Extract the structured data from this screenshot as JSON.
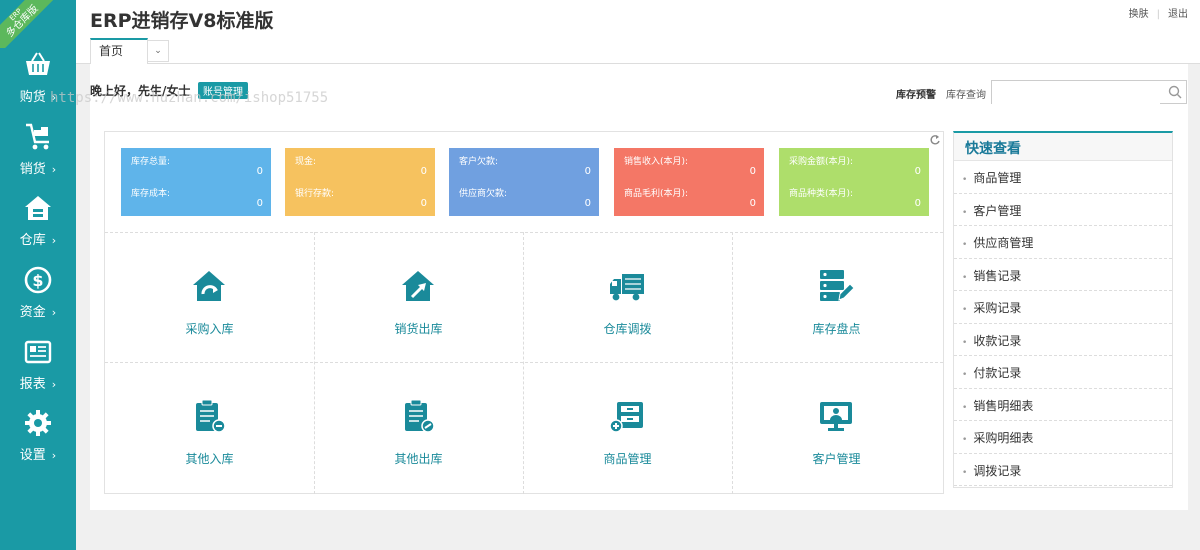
{
  "ribbon": {
    "small": "ERP",
    "text": "多仓库版"
  },
  "sidebar": {
    "items": [
      {
        "label": "购货",
        "chevron": "›",
        "icon": "basket-icon"
      },
      {
        "label": "销货",
        "chevron": "›",
        "icon": "cart-icon"
      },
      {
        "label": "仓库",
        "chevron": "›",
        "icon": "warehouse-icon"
      },
      {
        "label": "资金",
        "chevron": "›",
        "icon": "dollar-icon"
      },
      {
        "label": "报表",
        "chevron": "›",
        "icon": "report-icon"
      },
      {
        "label": "设置",
        "chevron": "›",
        "icon": "gear-icon"
      }
    ]
  },
  "header": {
    "title": "ERP进销存V8标准版",
    "links": {
      "switch": "换肤",
      "sep": "|",
      "logout": "退出"
    },
    "tab_home": "首页",
    "tab_dropdown": "⌄"
  },
  "content": {
    "greeting": "晚上好，先生/女士",
    "account_btn": "账号管理",
    "stock_warning": "库存预警",
    "stock_query": "库存查询",
    "search_placeholder": ""
  },
  "stats": [
    {
      "color": "#5fb4ea",
      "row1_label": "库存总量:",
      "row1_value": "0",
      "row2_label": "库存成本:",
      "row2_value": "0"
    },
    {
      "color": "#f6c25f",
      "row1_label": "现金:",
      "row1_value": "0",
      "row2_label": "银行存款:",
      "row2_value": "0"
    },
    {
      "color": "#70a0e0",
      "row1_label": "客户欠款:",
      "row1_value": "0",
      "row2_label": "供应商欠款:",
      "row2_value": "0"
    },
    {
      "color": "#f47766",
      "row1_label": "销售收入(本月):",
      "row1_value": "0",
      "row2_label": "商品毛利(本月):",
      "row2_value": "0"
    },
    {
      "color": "#aede6b",
      "row1_label": "采购金额(本月):",
      "row1_value": "0",
      "row2_label": "商品种类(本月):",
      "row2_value": "0"
    }
  ],
  "tiles": [
    {
      "label": "采购入库",
      "icon": "purchase-in-icon"
    },
    {
      "label": "销货出库",
      "icon": "sales-out-icon"
    },
    {
      "label": "仓库调拨",
      "icon": "truck-icon"
    },
    {
      "label": "库存盘点",
      "icon": "inventory-check-icon"
    },
    {
      "label": "其他入库",
      "icon": "other-in-icon"
    },
    {
      "label": "其他出库",
      "icon": "other-out-icon"
    },
    {
      "label": "商品管理",
      "icon": "goods-icon"
    },
    {
      "label": "客户管理",
      "icon": "customer-icon"
    }
  ],
  "quick": {
    "title": "快速查看",
    "bullet": "•",
    "items": [
      "商品管理",
      "客户管理",
      "供应商管理",
      "销售记录",
      "采购记录",
      "收款记录",
      "付款记录",
      "销售明细表",
      "采购明细表",
      "调拨记录"
    ]
  },
  "watermark": "https://www.huzhan.com/ishop51755",
  "colors": {
    "primary": "#1a9aa5",
    "accent_green": "#5cb85c"
  }
}
